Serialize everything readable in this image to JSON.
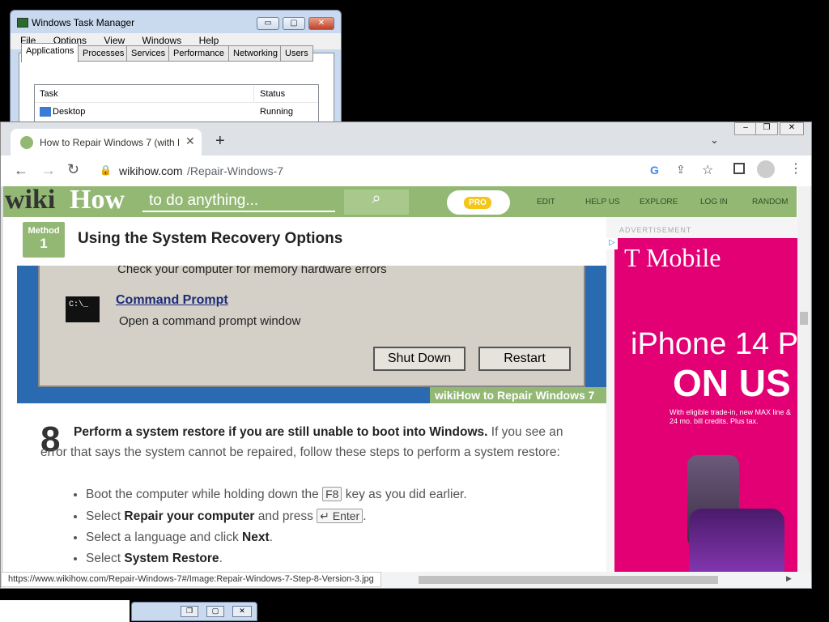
{
  "task_manager": {
    "title": "Windows Task Manager",
    "menu": [
      "File",
      "Options",
      "View",
      "Windows",
      "Help"
    ],
    "tabs": [
      "Applications",
      "Processes",
      "Services",
      "Performance",
      "Networking",
      "Users"
    ],
    "columns": {
      "task": "Task",
      "status": "Status"
    },
    "rows": [
      {
        "task": "Desktop",
        "status": "Running"
      }
    ],
    "controls": {
      "minimize": "▭",
      "maximize": "▢",
      "close": "✕"
    }
  },
  "browser": {
    "tab_title": "How to Repair Windows 7 (with P",
    "url_domain": "wikihow.com",
    "url_path": "/Repair-Windows-7",
    "status_url": "https://www.wikihow.com/Repair-Windows-7#/Image:Repair-Windows-7-Step-8-Version-3.jpg"
  },
  "wikihow": {
    "logo_wiki": "wiki",
    "logo_how": "How",
    "search_placeholder": "to do anything...",
    "pro": "PRO",
    "nav": [
      "EDIT",
      "HELP US",
      "EXPLORE",
      "LOG IN",
      "RANDOM"
    ],
    "method_label": "Method",
    "method_number": "1",
    "method_title": "Using the System Recovery Options",
    "image": {
      "line_top": "Check your computer for memory hardware errors",
      "cmd_title": "Command Prompt",
      "cmd_desc": "Open a command prompt window",
      "cmd_icon_text": "C:\\_",
      "shutdown": "Shut Down",
      "restart": "Restart",
      "watermark": "wikiHow to Repair Windows 7"
    },
    "step_number": "8",
    "step_bold": "Perform a system restore if you are still unable to boot into Windows.",
    "step_text": " If you see an error that says the system cannot be repaired, follow these steps to perform a system restore:",
    "bullets": [
      {
        "pre": "Boot the computer while holding down the ",
        "key": "F8",
        "post": " key as you did earlier."
      },
      {
        "pre": "Select ",
        "bold": "Repair your computer",
        "mid": " and press ",
        "key": "↵ Enter",
        "post": "."
      },
      {
        "pre": "Select a language and click ",
        "bold": "Next",
        "post": "."
      },
      {
        "pre": "Select ",
        "bold": "System Restore",
        "post": "."
      }
    ],
    "ad_label": "ADVERTISEMENT",
    "ad": {
      "brand": "T Mobile",
      "headline1": "iPhone 14 P",
      "headline2": "ON US",
      "fine": "With eligible trade-in, new MAX line & 24 mo. bill credits. Plus tax."
    }
  },
  "colors": {
    "wikihow_green": "#93b874",
    "tmobile_magenta": "#e20074",
    "pro_yellow": "#f5c518"
  }
}
